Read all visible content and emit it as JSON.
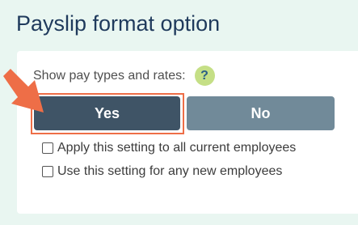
{
  "header": {
    "title": "Payslip format option"
  },
  "setting": {
    "question_label": "Show pay types and rates:",
    "help_icon_symbol": "?",
    "yes_label": "Yes",
    "no_label": "No",
    "selected": "Yes"
  },
  "options": [
    {
      "label": "Apply this setting to all current employees",
      "checked": false
    },
    {
      "label": "Use this setting for any new employees",
      "checked": false
    }
  ],
  "annotation": {
    "arrow_color": "#ee6e47",
    "highlight_color": "#ee6e47"
  },
  "icons": {
    "help": "question-mark-circle",
    "pointer": "arrow"
  }
}
